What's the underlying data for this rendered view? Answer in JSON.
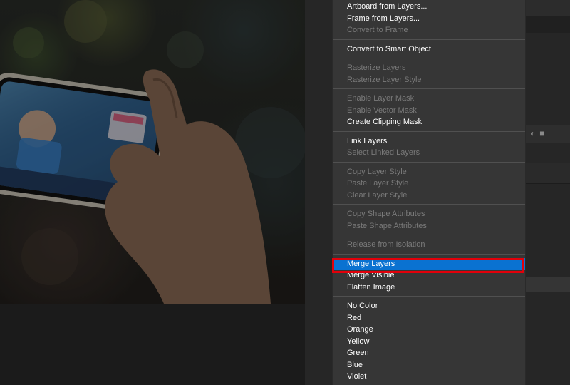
{
  "context_menu": {
    "groups": [
      [
        {
          "label": "Artboard from Layers...",
          "enabled": true
        },
        {
          "label": "Frame from Layers...",
          "enabled": true
        },
        {
          "label": "Convert to Frame",
          "enabled": false
        }
      ],
      [
        {
          "label": "Convert to Smart Object",
          "enabled": true
        }
      ],
      [
        {
          "label": "Rasterize Layers",
          "enabled": false
        },
        {
          "label": "Rasterize Layer Style",
          "enabled": false
        }
      ],
      [
        {
          "label": "Enable Layer Mask",
          "enabled": false
        },
        {
          "label": "Enable Vector Mask",
          "enabled": false
        },
        {
          "label": "Create Clipping Mask",
          "enabled": true
        }
      ],
      [
        {
          "label": "Link Layers",
          "enabled": true
        },
        {
          "label": "Select Linked Layers",
          "enabled": false
        }
      ],
      [
        {
          "label": "Copy Layer Style",
          "enabled": false
        },
        {
          "label": "Paste Layer Style",
          "enabled": false
        },
        {
          "label": "Clear Layer Style",
          "enabled": false
        }
      ],
      [
        {
          "label": "Copy Shape Attributes",
          "enabled": false
        },
        {
          "label": "Paste Shape Attributes",
          "enabled": false
        }
      ],
      [
        {
          "label": "Release from Isolation",
          "enabled": false
        }
      ],
      [
        {
          "label": "Merge Layers",
          "enabled": true,
          "highlighted": true
        },
        {
          "label": "Merge Visible",
          "enabled": true
        },
        {
          "label": "Flatten Image",
          "enabled": true
        }
      ],
      [
        {
          "label": "No Color",
          "enabled": true
        },
        {
          "label": "Red",
          "enabled": true
        },
        {
          "label": "Orange",
          "enabled": true
        },
        {
          "label": "Yellow",
          "enabled": true
        },
        {
          "label": "Green",
          "enabled": true
        },
        {
          "label": "Blue",
          "enabled": true
        },
        {
          "label": "Violet",
          "enabled": true
        }
      ]
    ]
  },
  "colors": {
    "highlight": "#0a72d1",
    "annotation_box": "#e2000a",
    "menu_bg": "#363636"
  },
  "icons": {
    "layers_panel": [
      "adjustment-layer-icon",
      "new-group-folder-icon"
    ]
  }
}
